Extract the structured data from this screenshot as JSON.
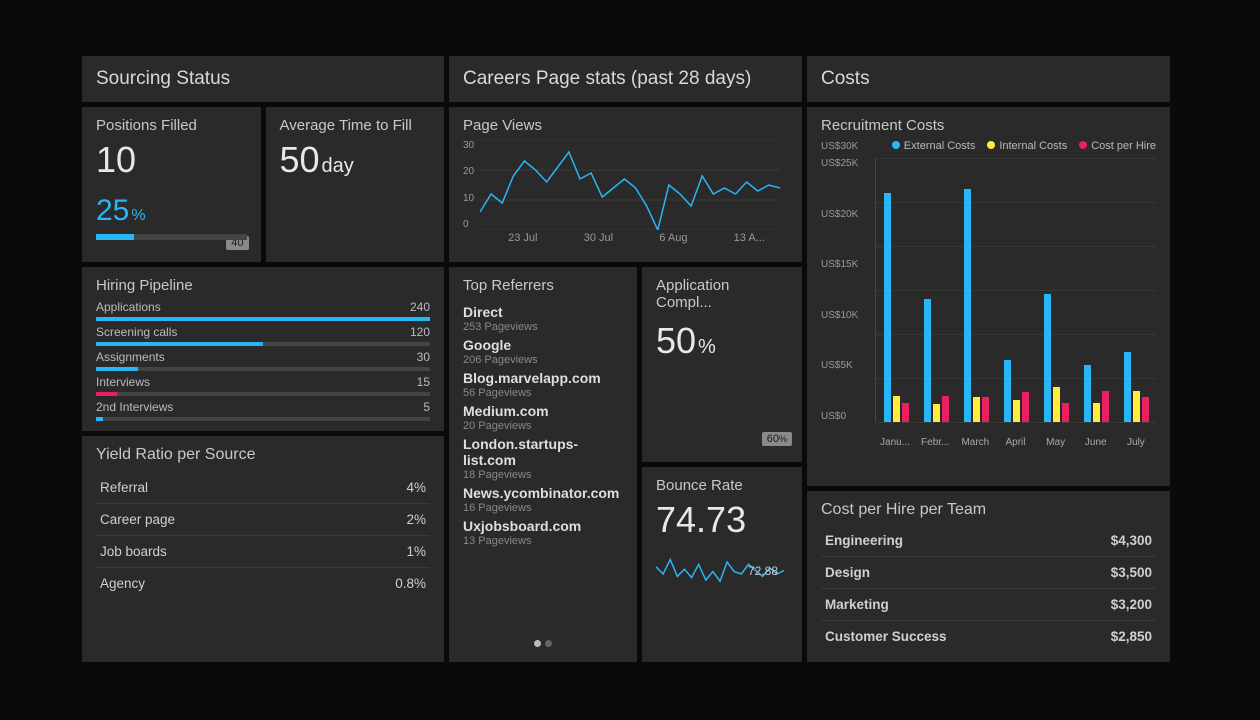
{
  "sourcing": {
    "title": "Sourcing Status",
    "positions_filled": {
      "label": "Positions Filled",
      "value": "10",
      "pct": "25",
      "target": "40",
      "progress": 25
    },
    "avg_time": {
      "label": "Average Time to Fill",
      "value": "50",
      "unit": "day"
    },
    "pipeline": {
      "title": "Hiring Pipeline",
      "items": [
        {
          "label": "Applications",
          "value": "240",
          "pct": 100,
          "color": "#29b6f6"
        },
        {
          "label": "Screening calls",
          "value": "120",
          "pct": 50,
          "color": "#29b6f6"
        },
        {
          "label": "Assignments",
          "value": "30",
          "pct": 12.5,
          "color": "#29b6f6"
        },
        {
          "label": "Interviews",
          "value": "15",
          "pct": 6.25,
          "color": "#e91e63"
        },
        {
          "label": "2nd Interviews",
          "value": "5",
          "pct": 2.1,
          "color": "#29b6f6"
        }
      ]
    },
    "yield": {
      "title": "Yield Ratio per Source",
      "rows": [
        {
          "label": "Referral",
          "value": "4%"
        },
        {
          "label": "Career page",
          "value": "2%"
        },
        {
          "label": "Job boards",
          "value": "1%"
        },
        {
          "label": "Agency",
          "value": "0.8%"
        }
      ]
    }
  },
  "careers": {
    "title": "Careers Page stats (past 28 days)",
    "page_views": {
      "title": "Page Views"
    },
    "referrers": {
      "title": "Top Referrers",
      "items": [
        {
          "name": "Direct",
          "sub": "253 Pageviews"
        },
        {
          "name": "Google",
          "sub": "206 Pageviews"
        },
        {
          "name": "Blog.marvelapp.com",
          "sub": "56 Pageviews"
        },
        {
          "name": "Medium.com",
          "sub": "20 Pageviews"
        },
        {
          "name": "London.startups-list.com",
          "sub": "18 Pageviews"
        },
        {
          "name": "News.ycombinator.com",
          "sub": "16 Pageviews"
        },
        {
          "name": "Uxjobsboard.com",
          "sub": "13 Pageviews"
        }
      ]
    },
    "app_completion": {
      "title": "Application Compl...",
      "value": "50",
      "badge": "60"
    },
    "bounce": {
      "title": "Bounce Rate",
      "value": "74.73",
      "spark_last": "72.88"
    }
  },
  "costs": {
    "title": "Costs",
    "recruitment": {
      "title": "Recruitment Costs",
      "legend": [
        {
          "label": "External Costs",
          "color": "#29b6f6"
        },
        {
          "label": "Internal Costs",
          "color": "#ffeb3b"
        },
        {
          "label": "Cost per Hire",
          "color": "#e91e63"
        }
      ],
      "ylabels": [
        "US$30K",
        "US$25K",
        "US$20K",
        "US$15K",
        "US$10K",
        "US$5K",
        "US$0"
      ]
    },
    "cph_team": {
      "title": "Cost per Hire per Team",
      "rows": [
        {
          "label": "Engineering",
          "value": "$4,300"
        },
        {
          "label": "Design",
          "value": "$3,500"
        },
        {
          "label": "Marketing",
          "value": "$3,200"
        },
        {
          "label": "Customer Success",
          "value": "$2,850"
        }
      ]
    }
  },
  "chart_data": [
    {
      "type": "line",
      "name": "page_views",
      "title": "Page Views",
      "xticks": [
        "23 Jul",
        "30 Jul",
        "6 Aug",
        "13 A..."
      ],
      "yticks": [
        0,
        10,
        20,
        30
      ],
      "ylim": [
        0,
        30
      ],
      "values": [
        6,
        12,
        9,
        18,
        23,
        20,
        16,
        21,
        26,
        17,
        19,
        11,
        14,
        17,
        14,
        8,
        0,
        15,
        12,
        8,
        18,
        12,
        14,
        12,
        16,
        13,
        15,
        14
      ]
    },
    {
      "type": "bar",
      "name": "recruitment_costs",
      "title": "Recruitment Costs",
      "categories": [
        "Janu...",
        "Febr...",
        "March",
        "April",
        "May",
        "June",
        "July"
      ],
      "ylim": [
        0,
        30000
      ],
      "ylabel_prefix": "US$",
      "series": [
        {
          "name": "External Costs",
          "color": "#29b6f6",
          "values": [
            26000,
            14000,
            26500,
            7000,
            14500,
            6500,
            8000
          ]
        },
        {
          "name": "Internal Costs",
          "color": "#ffeb3b",
          "values": [
            3000,
            2000,
            2800,
            2500,
            4000,
            2200,
            3500
          ]
        },
        {
          "name": "Cost per Hire",
          "color": "#e91e63",
          "values": [
            2200,
            3000,
            2800,
            3400,
            2200,
            3500,
            2800
          ]
        }
      ]
    },
    {
      "type": "line",
      "name": "bounce_rate_spark",
      "title": "Bounce Rate",
      "ylim": [
        60,
        90
      ],
      "last_value": 72.88,
      "values": [
        76,
        70,
        82,
        68,
        74,
        67,
        78,
        65,
        72,
        64,
        80,
        72,
        70,
        78,
        73,
        68,
        75,
        70,
        72.88
      ]
    }
  ]
}
